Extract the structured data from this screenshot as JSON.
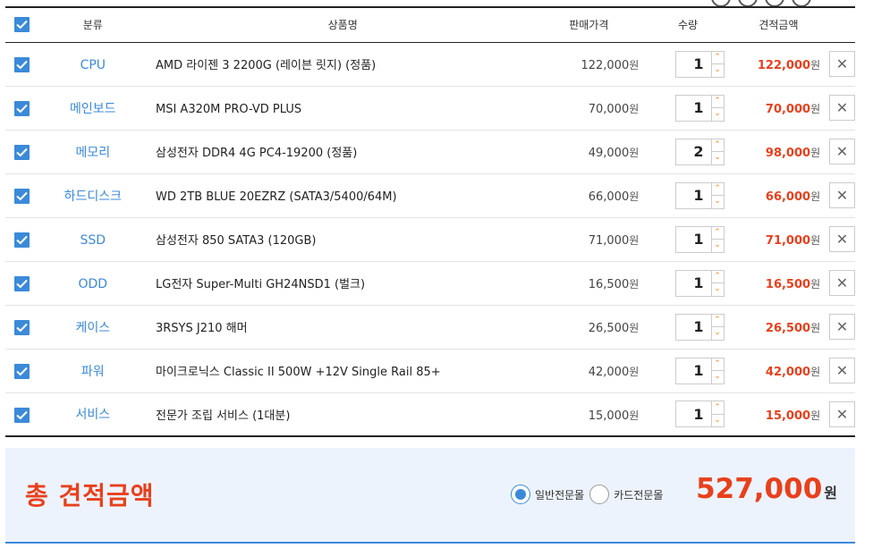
{
  "header": {
    "col_category": "분류",
    "col_product": "상품명",
    "col_price": "판매가격",
    "col_qty": "수량",
    "col_total": "견적금액"
  },
  "currency": "원",
  "items": [
    {
      "category": "CPU",
      "name": "AMD 라이젠 3 2200G (레이븐 릿지) (정품)",
      "price": "122,000",
      "qty": "1",
      "total": "122,000"
    },
    {
      "category": "메인보드",
      "name": "MSI A320M PRO-VD PLUS",
      "price": "70,000",
      "qty": "1",
      "total": "70,000"
    },
    {
      "category": "메모리",
      "name": "삼성전자 DDR4 4G PC4-19200 (정품)",
      "price": "49,000",
      "qty": "2",
      "total": "98,000"
    },
    {
      "category": "하드디스크",
      "name": "WD 2TB BLUE 20EZRZ (SATA3/5400/64M)",
      "price": "66,000",
      "qty": "1",
      "total": "66,000"
    },
    {
      "category": "SSD",
      "name": "삼성전자 850 SATA3 (120GB)",
      "price": "71,000",
      "qty": "1",
      "total": "71,000"
    },
    {
      "category": "ODD",
      "name": "LG전자 Super-Multi GH24NSD1 (벌크)",
      "price": "16,500",
      "qty": "1",
      "total": "16,500"
    },
    {
      "category": "케이스",
      "name": "3RSYS J210 해머",
      "price": "26,500",
      "qty": "1",
      "total": "26,500"
    },
    {
      "category": "파워",
      "name": "마이크로닉스 Classic II 500W +12V Single Rail 85+",
      "price": "42,000",
      "qty": "1",
      "total": "42,000"
    },
    {
      "category": "서비스",
      "name": "전문가 조립 서비스 (1대분)",
      "price": "15,000",
      "qty": "1",
      "total": "15,000"
    }
  ],
  "summary": {
    "label": "총 견적금액",
    "option_general": "일반전문몰",
    "option_card": "카드전문몰",
    "selected": "일반전문몰",
    "amount": "527,000",
    "currency": "원"
  },
  "colors": {
    "accent": "#3b8ad9",
    "total_red": "#e8401c",
    "spinner_orange": "#f08a24",
    "summary_bg": "#edf3fc"
  }
}
